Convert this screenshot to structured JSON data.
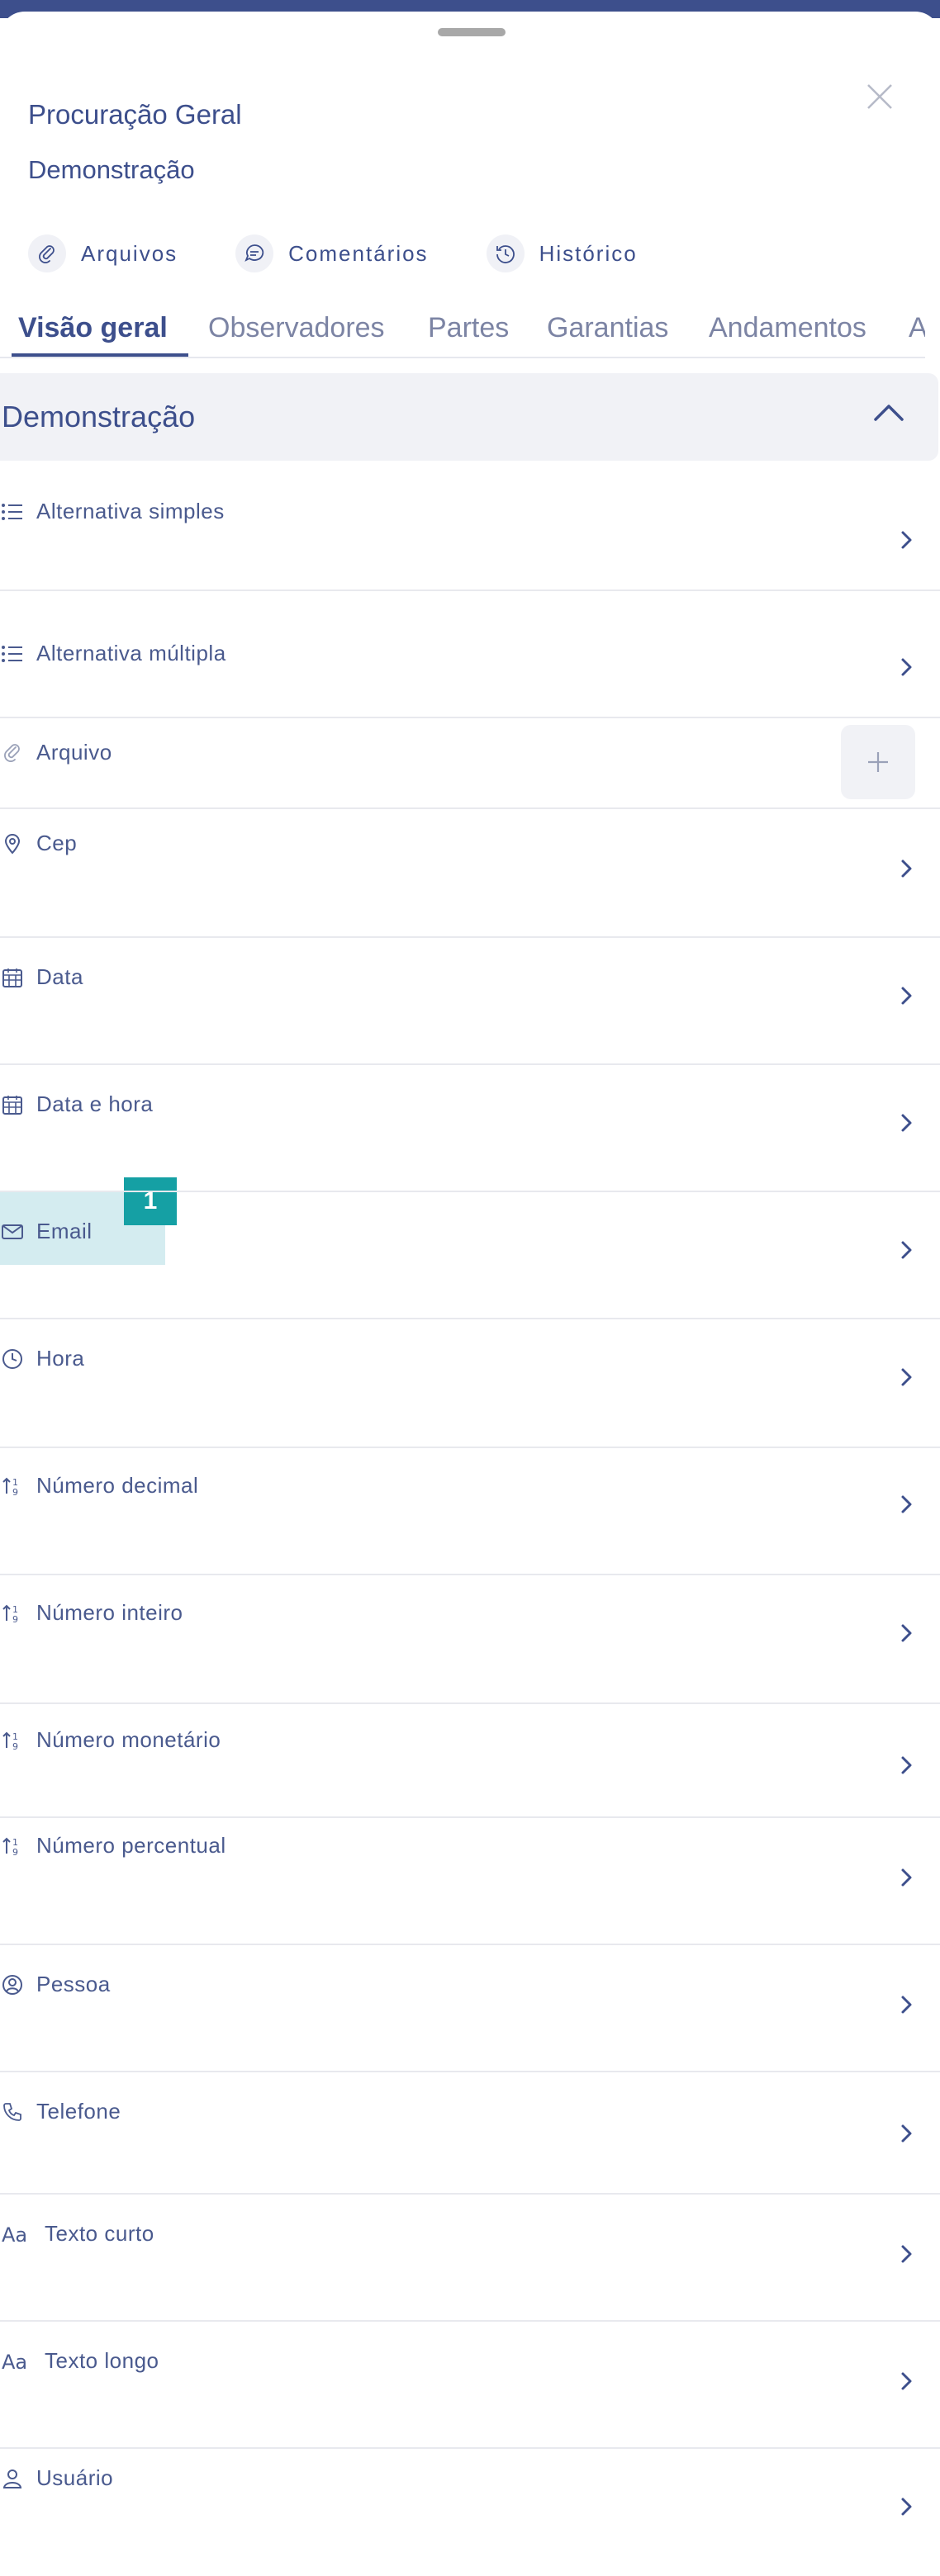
{
  "header": {
    "title": "Procuração Geral",
    "subtitle": "Demonstração"
  },
  "actions": [
    {
      "label": "Arquivos",
      "icon": "paperclip-icon"
    },
    {
      "label": "Comentários",
      "icon": "comment-icon"
    },
    {
      "label": "Histórico",
      "icon": "history-icon"
    }
  ],
  "tabs": [
    {
      "label": "Visão geral",
      "active": true
    },
    {
      "label": "Observadores"
    },
    {
      "label": "Partes"
    },
    {
      "label": "Garantias"
    },
    {
      "label": "Andamentos"
    },
    {
      "label": "A"
    }
  ],
  "section": {
    "title": "Demonstração",
    "expanded": true
  },
  "fields": [
    {
      "label": "Alternativa simples",
      "icon": "list-icon"
    },
    {
      "label": "Alternativa múltipla",
      "icon": "list-icon"
    },
    {
      "label": "Arquivo",
      "icon": "paperclip-icon"
    },
    {
      "label": "Cep",
      "icon": "location-pin-icon"
    },
    {
      "label": "Data",
      "icon": "calendar-icon"
    },
    {
      "label": "Data e hora",
      "icon": "calendar-icon"
    },
    {
      "label": "Email",
      "icon": "envelope-icon"
    },
    {
      "label": "Hora",
      "icon": "clock-icon"
    },
    {
      "label": "Número decimal",
      "icon": "number-sort-icon"
    },
    {
      "label": "Número inteiro",
      "icon": "number-sort-icon"
    },
    {
      "label": "Número monetário",
      "icon": "number-sort-icon"
    },
    {
      "label": "Número percentual",
      "icon": "number-sort-icon"
    },
    {
      "label": "Pessoa",
      "icon": "person-circle-icon"
    },
    {
      "label": "Telefone",
      "icon": "phone-icon"
    },
    {
      "label": "Texto curto",
      "icon": "text-icon"
    },
    {
      "label": "Texto longo",
      "icon": "text-icon"
    },
    {
      "label": "Usuário",
      "icon": "user-icon"
    }
  ],
  "annotation": {
    "badge": "1"
  },
  "colors": {
    "primary": "#3d4f8c",
    "muted": "#7c84a4",
    "highlight": "#d4ecf0",
    "badge": "#15a0a4"
  }
}
